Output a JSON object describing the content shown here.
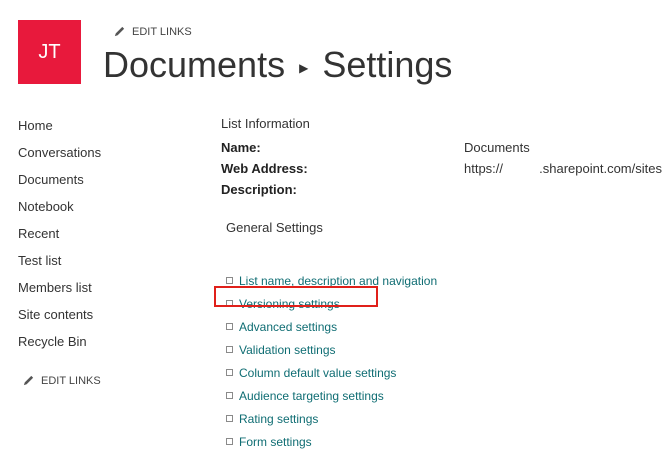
{
  "header": {
    "logo_initials": "JT",
    "logo_color": "#e8193c",
    "edit_links_label": "EDIT LINKS",
    "breadcrumb": [
      "Documents",
      "Settings"
    ]
  },
  "nav": {
    "items": [
      "Home",
      "Conversations",
      "Documents",
      "Notebook",
      "Recent",
      "Test list",
      "Members list",
      "Site contents",
      "Recycle Bin"
    ],
    "edit_links_label": "EDIT LINKS"
  },
  "list_info": {
    "title": "List Information",
    "fields": [
      {
        "label": "Name:",
        "value": "Documents"
      },
      {
        "label": "Web Address:",
        "value": "https://          .sharepoint.com/sites"
      },
      {
        "label": "Description:",
        "value": ""
      }
    ]
  },
  "general_settings": {
    "title": "General Settings",
    "links": [
      "List name, description and navigation",
      "Versioning settings",
      "Advanced settings",
      "Validation settings",
      "Column default value settings",
      "Audience targeting settings",
      "Rating settings",
      "Form settings"
    ],
    "highlighted": "Versioning settings",
    "highlight_color": "#e0201a",
    "link_color": "#0f6d73"
  }
}
